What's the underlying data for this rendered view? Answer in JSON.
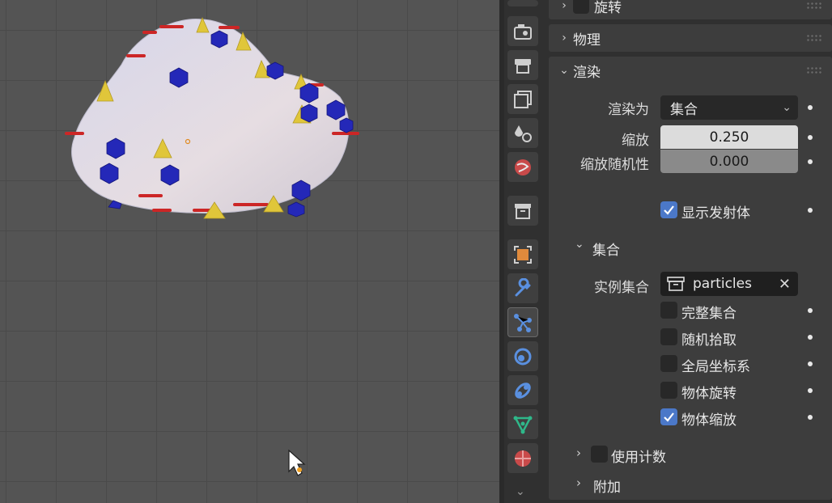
{
  "viewport": {
    "cursor_icon": "mouse-pointer-icon",
    "colors": {
      "mesh": "#dad8e6",
      "icosphere": "#2024b0",
      "cone": "#e0c63a",
      "bar": "#cc2626"
    }
  },
  "tabs": {
    "icons": [
      "tool-icon",
      "render-icon",
      "output-icon",
      "view-layer-icon",
      "scene-icon",
      "world-icon",
      "collection-icon",
      "object-icon",
      "modifier-icon",
      "particles-icon",
      "physics-icon",
      "constraints-icon",
      "object-data-icon",
      "material-icon"
    ],
    "active": "particles-icon"
  },
  "panels": {
    "rotation": {
      "title": "旋转"
    },
    "physics": {
      "title": "物理"
    },
    "render": {
      "title": "渲染",
      "render_as_label": "渲染为",
      "render_as_value": "集合",
      "scale_label": "缩放",
      "scale_value": "0.250",
      "scale_random_label": "缩放随机性",
      "scale_random_value": "0.000",
      "show_emitter_label": "显示发射体",
      "show_emitter_checked": true
    },
    "collection": {
      "title": "集合",
      "instance_label": "实例集合",
      "instance_value": "particles",
      "options": [
        {
          "label": "完整集合",
          "checked": false
        },
        {
          "label": "随机拾取",
          "checked": false
        },
        {
          "label": "全局坐标系",
          "checked": false
        },
        {
          "label": "物体旋转",
          "checked": false
        },
        {
          "label": "物体缩放",
          "checked": true
        }
      ],
      "use_count_label": "使用计数"
    },
    "extra": {
      "title": "附加"
    }
  }
}
